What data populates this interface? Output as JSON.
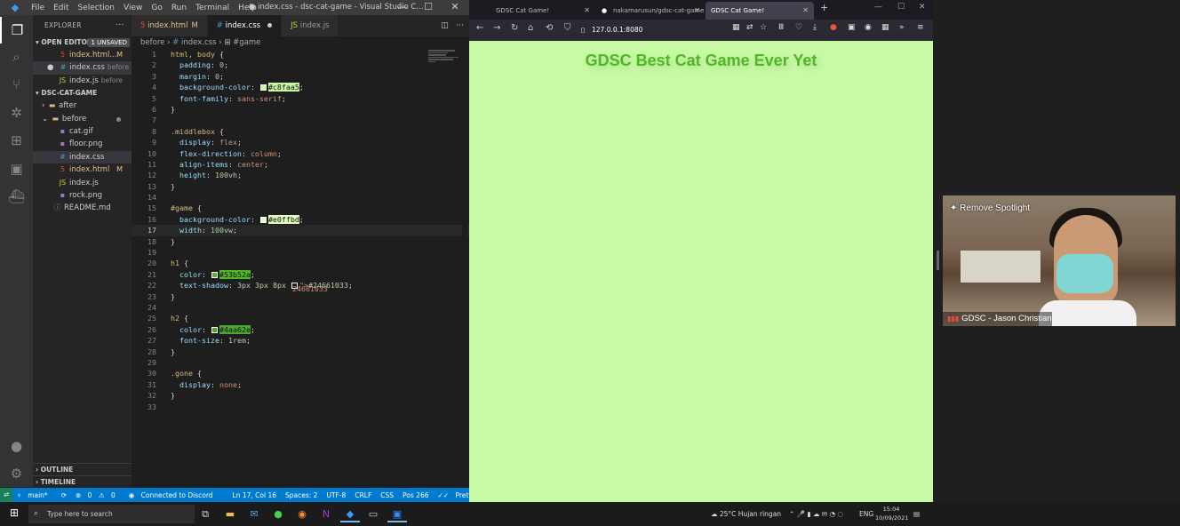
{
  "vscode": {
    "menu": [
      "File",
      "Edit",
      "Selection",
      "View",
      "Go",
      "Run",
      "Terminal",
      "Help"
    ],
    "window_title": "● index.css - dsc-cat-game - Visual Studio C...",
    "explorer": {
      "title": "EXPLORER",
      "open_editors": {
        "label": "OPEN EDITORS",
        "badge": "1 UNSAVED",
        "items": [
          {
            "name": "index.html...",
            "mark": "M"
          },
          {
            "name": "index.css",
            "ref": "before"
          },
          {
            "name": "index.js",
            "ref": "before"
          }
        ]
      },
      "project": {
        "label": "DSC-CAT-GAME",
        "items": [
          {
            "name": "after"
          },
          {
            "name": "before"
          },
          {
            "name": "cat.gif"
          },
          {
            "name": "floor.png"
          },
          {
            "name": "index.css"
          },
          {
            "name": "index.html",
            "mark": "M"
          },
          {
            "name": "index.js"
          },
          {
            "name": "rock.png"
          },
          {
            "name": "README.md"
          }
        ]
      },
      "outline": "OUTLINE",
      "timeline": "TIMELINE"
    },
    "tabs": [
      {
        "label": "index.html",
        "mark": "M"
      },
      {
        "label": "index.css"
      },
      {
        "label": "index.js"
      }
    ],
    "breadcrumb": {
      "folder": "before",
      "file": "index.css",
      "symbol": "#game"
    },
    "code_lines": [
      "html, body {",
      "  padding: 0;",
      "  margin: 0;",
      "  background-color: #c8faa5;",
      "  font-family: sans-serif;",
      "}",
      "",
      ".middlebox {",
      "  display: flex;",
      "  flex-direction: column;",
      "  align-items: center;",
      "  height: 100vh;",
      "}",
      "",
      "#game {",
      "  background-color: #e0ffbd;",
      "  width: 100vw;",
      "}",
      "",
      "h1 {",
      "  color: #53b52a;",
      "  text-shadow: 3px 3px 8px #24661033;",
      "}",
      "",
      "h2 {",
      "  color: #4aa62e;",
      "  font-size: 1rem;",
      "}",
      "",
      ".gone {",
      "  display: none;",
      "}",
      ""
    ],
    "swatches": {
      "c8faa5": "#c8faa5",
      "e0ffbd": "#e0ffbd",
      "53b52a": "#53b52a",
      "4aa62e": "#4aa62e",
      "24661033": "#24661033"
    },
    "status": {
      "branch": "main*",
      "errors": "0",
      "warnings": "0",
      "discord": "Connected to Discord",
      "position": "Ln 17, Col 16",
      "spaces": "Spaces: 2",
      "encoding": "UTF-8",
      "eol": "CRLF",
      "lang": "CSS",
      "pos": "Pos 266",
      "prettier": "Prettier"
    }
  },
  "firefox": {
    "tabs": [
      "GDSC Cat Game!",
      "nakamarusun/gdsc-cat-game",
      "GDSC Cat Game!"
    ],
    "url": "127.0.0.1:8080",
    "page_heading": "GDSC Best Cat Game Ever Yet"
  },
  "spotlight": {
    "action": "Remove Spotlight",
    "participant": "GDSC - Jason Christian"
  },
  "taskbar": {
    "search_placeholder": "Type here to search",
    "weather": "25°C  Hujan ringan",
    "lang": "ENG",
    "time": "15:04",
    "date": "10/09/2021"
  }
}
